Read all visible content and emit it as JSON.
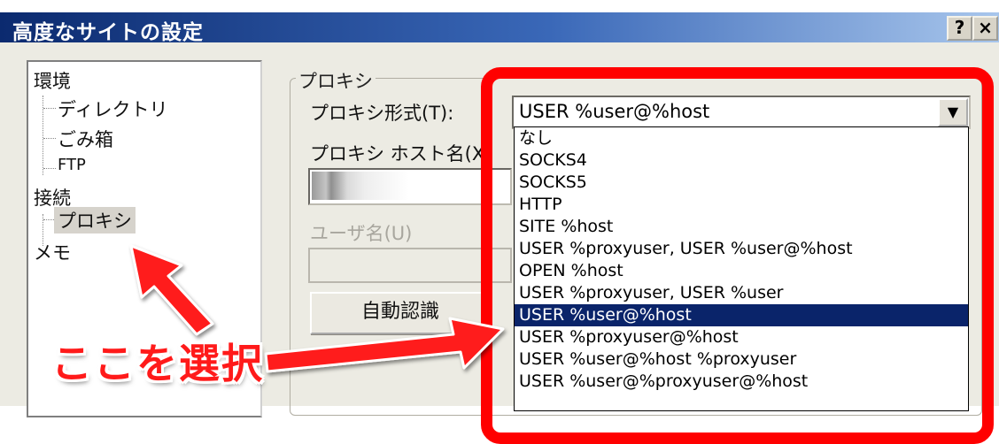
{
  "window": {
    "title": "高度なサイトの設定",
    "help_label": "?",
    "close_label": "×"
  },
  "tree": {
    "items": [
      {
        "label": "環境"
      },
      {
        "label": "ディレクトリ"
      },
      {
        "label": "ごみ箱"
      },
      {
        "label": "FTP"
      },
      {
        "label": "接続"
      },
      {
        "label": "プロキシ"
      },
      {
        "label": "メモ"
      }
    ],
    "selected": "プロキシ"
  },
  "proxy": {
    "group_title": "プロキシ",
    "type_label": "プロキシ形式(T):",
    "host_label": "プロキシ ホスト名(X)",
    "user_label": "ユーザ名(U)",
    "auto_button_label": "自動認識",
    "selected_value": "USER %user@%host",
    "options": [
      "なし",
      "SOCKS4",
      "SOCKS5",
      "HTTP",
      "SITE %host",
      "USER %proxyuser, USER %user@%host",
      "OPEN %host",
      "USER %proxyuser, USER %user",
      "USER %user@%host",
      "USER %proxyuser@%host",
      "USER %user@%host %proxyuser",
      "USER %user@%proxyuser@%host"
    ]
  },
  "annotation": {
    "callout_text": "ここを選択"
  },
  "colors": {
    "title_gradient_start": "#0b2a6f",
    "title_gradient_end": "#a8c6ec",
    "highlight_red": "#ff0000",
    "selection_blue": "#0a246a"
  }
}
